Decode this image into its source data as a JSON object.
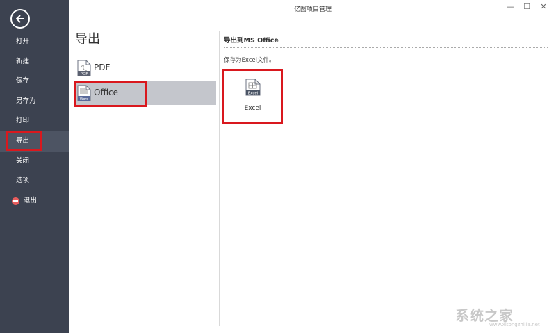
{
  "window": {
    "title": "亿图项目管理",
    "minimize": "—",
    "maximize": "☐",
    "close": "✕"
  },
  "sidebar": {
    "back_icon": "back-arrow-icon",
    "items": [
      {
        "label": "打开"
      },
      {
        "label": "新建"
      },
      {
        "label": "保存"
      },
      {
        "label": "另存为"
      },
      {
        "label": "打印"
      },
      {
        "label": "导出",
        "active": true
      },
      {
        "label": "关闭"
      },
      {
        "label": "选项"
      },
      {
        "label": "退出",
        "icon": "exit-icon"
      }
    ]
  },
  "middle": {
    "title": "导出",
    "options": [
      {
        "label": "PDF",
        "icon": "pdf-icon"
      },
      {
        "label": "Office",
        "icon": "word-icon",
        "selected": true
      }
    ]
  },
  "right": {
    "title": "导出到MS Office",
    "description": "保存为Excel文件。",
    "card": {
      "label": "Excel",
      "icon_text": "Excel",
      "icon": "excel-icon"
    }
  },
  "pdf_icon_text": "PDF",
  "word_icon_text": "Word",
  "watermark": {
    "text": "系统之家",
    "url": "www.xitongzhijia.net"
  },
  "colors": {
    "sidebar_bg": "#3c4250",
    "sidebar_active": "#4d5463",
    "selected_bg": "#c4c6cc",
    "highlight": "#d9181e"
  }
}
